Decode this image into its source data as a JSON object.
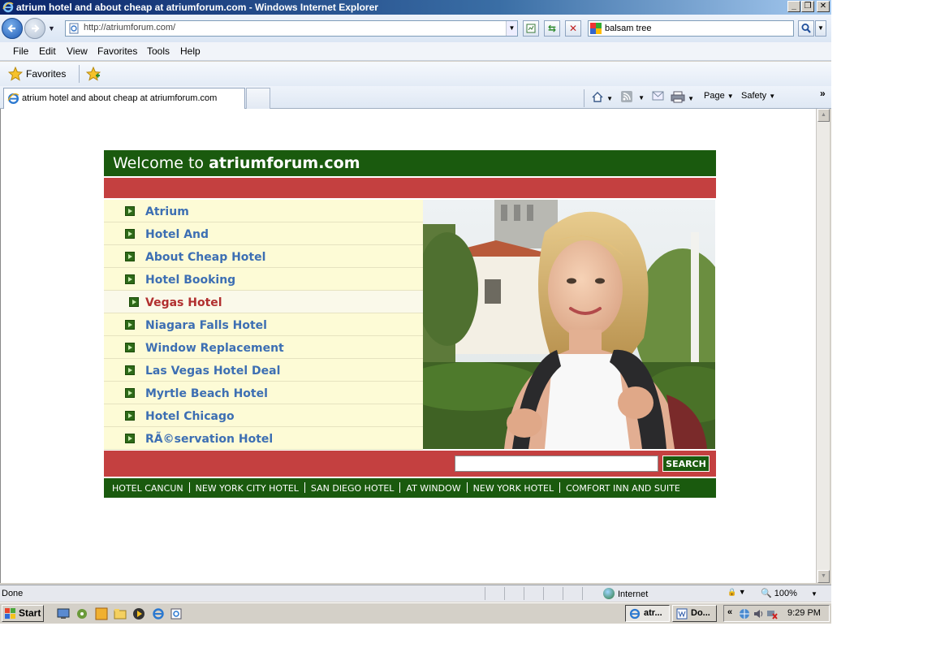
{
  "window": {
    "title": "atrium hotel and about cheap at atriumforum.com - Windows Internet Explorer",
    "controls": {
      "minimize": "_",
      "restore": "❐",
      "close": "✕"
    }
  },
  "address_bar": {
    "url": "http://atriumforum.com/",
    "search_value": "balsam tree"
  },
  "menu": [
    "File",
    "Edit",
    "View",
    "Favorites",
    "Tools",
    "Help"
  ],
  "favorites_bar": {
    "favorites_label": "Favorites"
  },
  "tab": {
    "label": "atrium hotel and about cheap at atriumforum.com"
  },
  "command_bar": {
    "page": "Page",
    "safety": "Safety"
  },
  "site": {
    "welcome": "Welcome to ",
    "domain": "atriumforum.com",
    "nav_items": [
      "Atrium",
      "Hotel And",
      "About Cheap Hotel",
      "Hotel Booking",
      "Vegas Hotel",
      "Niagara Falls Hotel",
      "Window Replacement",
      "Las Vegas Hotel Deal",
      "Myrtle Beach Hotel",
      "Hotel Chicago",
      "RÃ©servation Hotel"
    ],
    "current_nav_index": 4,
    "search_button": "SEARCH",
    "search_value": "",
    "footer_links": [
      "HOTEL CANCUN",
      "NEW YORK CITY HOTEL",
      "SAN DIEGO HOTEL",
      "AT WINDOW",
      "NEW YORK HOTEL",
      "COMFORT INN AND SUITE"
    ]
  },
  "status_bar": {
    "status": "Done",
    "zone": "Internet",
    "zoom": "100%"
  },
  "taskbar": {
    "start": "Start",
    "tasks": [
      "atr...",
      "Do..."
    ],
    "clock": "9:29 PM"
  },
  "colors": {
    "site_green": "#1a5a0e",
    "site_red": "#c44040",
    "nav_bg": "#fdfbd6",
    "nav_link": "#3d6fb3",
    "nav_current": "#b12f2f"
  },
  "icons": {
    "back": "back-arrow-icon",
    "forward": "forward-arrow-icon",
    "refresh": "refresh-icon",
    "stop": "stop-icon",
    "home": "home-icon",
    "feeds": "rss-icon",
    "print": "printer-icon",
    "search_go": "magnifier-icon"
  }
}
